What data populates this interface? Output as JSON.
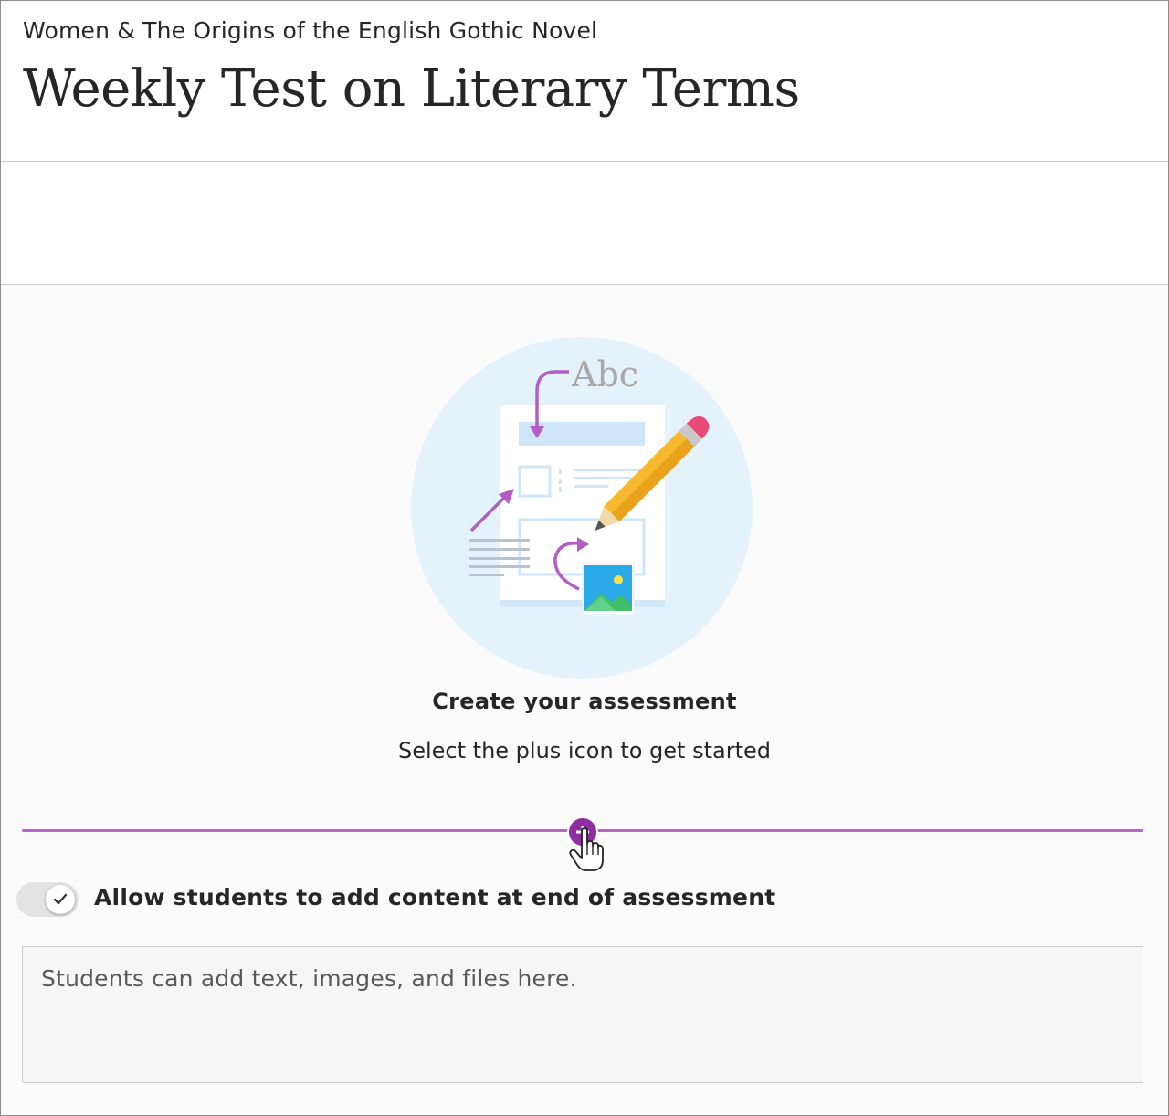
{
  "header": {
    "course_name": "Women & The Origins of the English Gothic Novel",
    "test_title": "Weekly Test on Literary Terms"
  },
  "illustration": {
    "icon": "assessment-illustration-icon",
    "abc_text": "Abc"
  },
  "empty_state": {
    "heading": "Create your assessment",
    "subtext": "Select the plus icon to get started"
  },
  "insert": {
    "icon": "plus-icon"
  },
  "student_content": {
    "toggle_on": true,
    "toggle_label": "Allow students to add content at end of assessment",
    "placeholder": "Students can add text, images, and files here."
  },
  "colors": {
    "accent": "#8e2ea0",
    "insert_line": "#b766c7",
    "illustration_circle": "#e4f2fc"
  }
}
